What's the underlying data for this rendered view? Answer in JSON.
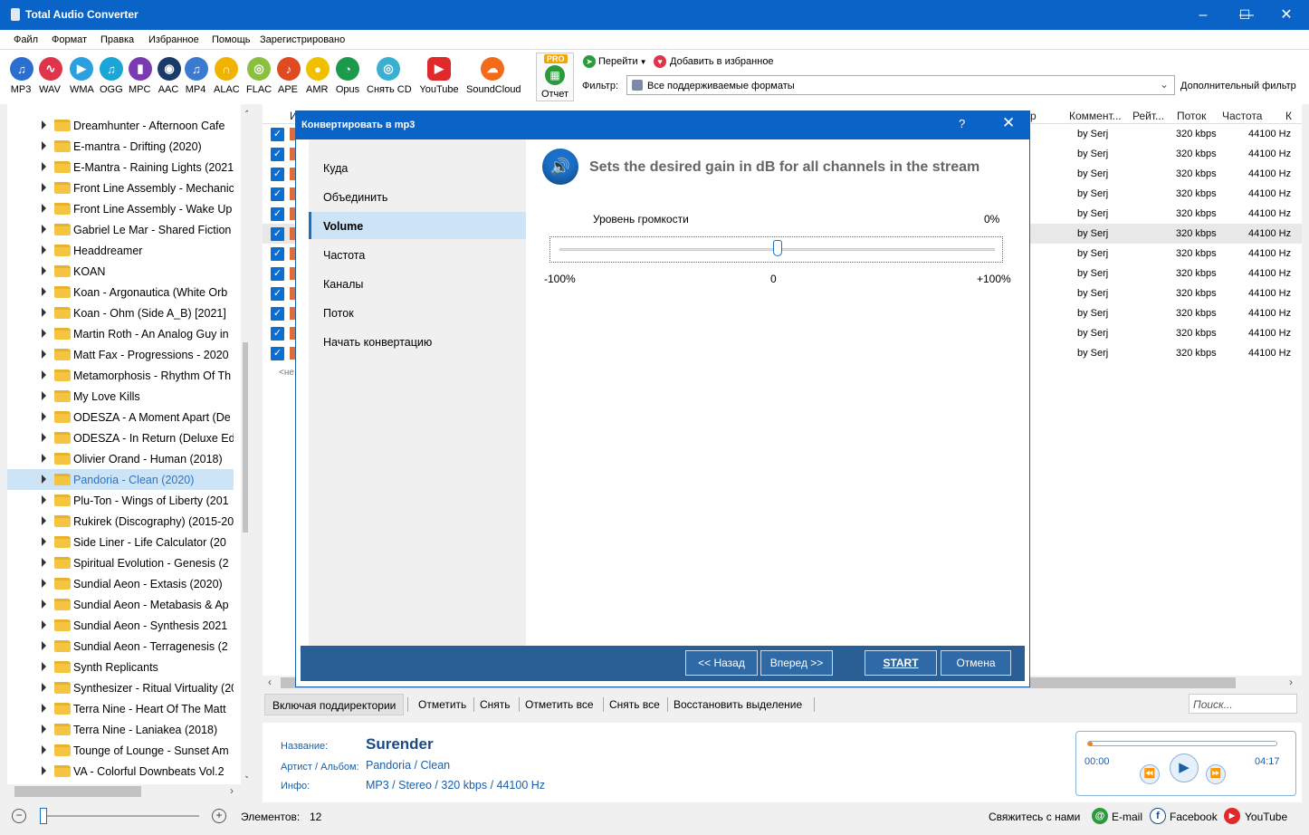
{
  "app": {
    "title": "Total Audio Converter"
  },
  "menu": [
    "Файл",
    "Формат",
    "Правка",
    "Избранное",
    "Помощь",
    "Зарегистрировано"
  ],
  "formats": [
    {
      "label": "MP3",
      "color": "#2a6fd0",
      "icon": "music-note-icon"
    },
    {
      "label": "WAV",
      "color": "#e0344a",
      "icon": "wave-icon"
    },
    {
      "label": "WMA",
      "color": "#2aa0e0",
      "icon": "play-icon"
    },
    {
      "label": "OGG",
      "color": "#1aa6d6",
      "icon": "music-note-icon"
    },
    {
      "label": "MPC",
      "color": "#7a3ab0",
      "icon": "bars-icon"
    },
    {
      "label": "AAC",
      "color": "#1a3a6a",
      "icon": "speaker-icon"
    },
    {
      "label": "MP4",
      "color": "#3a7ad0",
      "icon": "music-note-icon"
    },
    {
      "label": "ALAC",
      "color": "#f0b400",
      "icon": "headphones-icon"
    },
    {
      "label": "FLAC",
      "color": "#8ac040",
      "icon": "disc-icon"
    },
    {
      "label": "APE",
      "color": "#e04a20",
      "icon": "guitar-icon"
    },
    {
      "label": "AMR",
      "color": "#f0c000",
      "icon": "mic-icon"
    },
    {
      "label": "Opus",
      "color": "#1a9a4a",
      "icon": "opus-icon"
    },
    {
      "label": "Снять CD",
      "color": "#3ab0d0",
      "icon": "cd-icon"
    },
    {
      "label": "YouTube",
      "color": "#e02a2a",
      "icon": "youtube-icon"
    },
    {
      "label": "SoundCloud",
      "color": "#f26a1a",
      "icon": "cloud-icon"
    }
  ],
  "toolbar": {
    "pro_badge": "PRO",
    "report_label": "Отчет",
    "goto_label": "Перейти",
    "favorite_label": "Добавить в избранное",
    "filter_label": "Фильтр:",
    "filter_value": "Все поддерживаемые форматы",
    "advanced_filter": "Дополнительный фильтр"
  },
  "tree": {
    "selected_index": 18,
    "items": [
      "Dreamhunter - Afternoon Cafe",
      "E-mantra - Drifting (2020)",
      "E-Mantra - Raining Lights (2021",
      "Front Line Assembly - Mechanic",
      "Front Line Assembly - Wake Up",
      "Gabriel Le Mar - Shared Fiction",
      "Headdreamer",
      "KOAN",
      "Koan - Argonautica (White Orb",
      "Koan - Ohm (Side A_B) [2021]",
      "Martin Roth - An Analog Guy in",
      "Matt Fax - Progressions - 2020",
      "Metamorphosis - Rhythm Of Th",
      "My Love Kills",
      "ODESZA - A Moment Apart (De",
      "ODESZA - In Return (Deluxe Ed",
      "Olivier Orand - Human (2018)",
      "Pandoria - Clean (2020)",
      "Plu-Ton - Wings of Liberty (201",
      "Rukirek (Discography) (2015-20",
      "Side Liner - Life Calculator (20",
      "Spiritual Evolution - Genesis (2",
      "Sundial Aeon - Extasis (2020)",
      "Sundial Aeon - Metabasis & Ap",
      "Sundial Aeon - Synthesis 2021",
      "Sundial Aeon - Terragenesis (2",
      "Synth Replicants",
      "Synthesizer - Ritual Virtuality (20",
      "Terra Nine - Heart Of The Matt",
      "Terra Nine - Laniakea (2018)",
      "Tounge of Lounge - Sunset Am",
      "VA - Colorful Downbeats Vol.2"
    ]
  },
  "filelist": {
    "columns": {
      "name": "И",
      "comment": "Коммент...",
      "rating": "Рейт...",
      "bitrate": "Поток",
      "freq": "Частота",
      "p": "р",
      "k": "К"
    },
    "rows": [
      {
        "comment": "by Serj",
        "bitrate": "320 kbps",
        "freq": "44100 Hz"
      },
      {
        "comment": "by Serj",
        "bitrate": "320 kbps",
        "freq": "44100 Hz"
      },
      {
        "comment": "by Serj",
        "bitrate": "320 kbps",
        "freq": "44100 Hz"
      },
      {
        "comment": "by Serj",
        "bitrate": "320 kbps",
        "freq": "44100 Hz"
      },
      {
        "comment": "by Serj",
        "bitrate": "320 kbps",
        "freq": "44100 Hz"
      },
      {
        "comment": "by Serj",
        "bitrate": "320 kbps",
        "freq": "44100 Hz"
      },
      {
        "comment": "by Serj",
        "bitrate": "320 kbps",
        "freq": "44100 Hz"
      },
      {
        "comment": "by Serj",
        "bitrate": "320 kbps",
        "freq": "44100 Hz"
      },
      {
        "comment": "by Serj",
        "bitrate": "320 kbps",
        "freq": "44100 Hz"
      },
      {
        "comment": "by Serj",
        "bitrate": "320 kbps",
        "freq": "44100 Hz"
      },
      {
        "comment": "by Serj",
        "bitrate": "320 kbps",
        "freq": "44100 Hz"
      },
      {
        "comment": "by Serj",
        "bitrate": "320 kbps",
        "freq": "44100 Hz"
      }
    ],
    "no_header": "<не"
  },
  "actions": {
    "subdirs": "Включая поддиректории",
    "check": "Отметить",
    "uncheck": "Снять",
    "check_all": "Отметить все",
    "uncheck_all": "Снять все",
    "restore": "Восстановить выделение",
    "search_placeholder": "Поиск..."
  },
  "info": {
    "name_label": "Название:",
    "name_value": "Surender",
    "artist_label": "Артист / Альбом:",
    "artist_value": "Pandoria / Clean",
    "info_label": "Инфо:",
    "info_value": "MP3 / Stereo / 320 kbps / 44100 Hz"
  },
  "player": {
    "time_current": "00:00",
    "time_total": "04:17",
    "progress": 0.0
  },
  "status": {
    "items_label": "Элементов:",
    "items_count": "12",
    "contact": "Свяжитесь с нами",
    "email": "E-mail",
    "facebook": "Facebook",
    "youtube": "YouTube"
  },
  "dialog": {
    "title": "Конвертировать в mp3",
    "help": "?",
    "close": "✕",
    "nav": [
      "Куда",
      "Объединить",
      "Volume",
      "Частота",
      "Каналы",
      "Поток",
      "Начать конвертацию"
    ],
    "nav_selected": 2,
    "heading": "Sets the desired gain in dB for all channels in the stream",
    "level_label": "Уровень громкости",
    "level_value": "0%",
    "level_fraction": 0.5,
    "min_label": "-100%",
    "mid_label": "0",
    "max_label": "+100%",
    "back": "<< Назад",
    "next": "Вперед >>",
    "start": "START",
    "cancel": "Отмена"
  }
}
